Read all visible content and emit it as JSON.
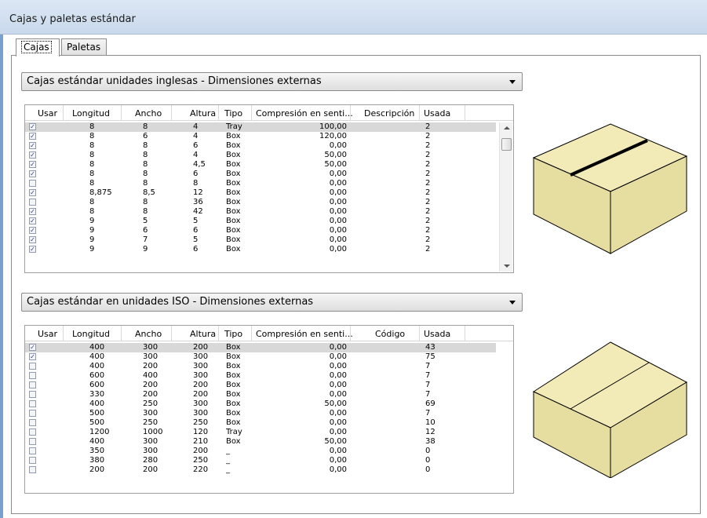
{
  "window": {
    "title": "Cajas y paletas estándar"
  },
  "tabs": [
    {
      "label": "Cajas",
      "active": true
    },
    {
      "label": "Paletas",
      "active": false
    }
  ],
  "english": {
    "dropdown": "Cajas estándar unidades inglesas - Dimensiones externas",
    "columns": [
      "Usar",
      "Longitud",
      "Ancho",
      "Altura",
      "Tipo",
      "Compresión en senti...",
      "Descripción",
      "Usada"
    ],
    "rows": [
      {
        "usar": true,
        "longitud": "8",
        "ancho": "8",
        "altura": "4",
        "tipo": "Tray",
        "compresion": "100,00",
        "descripcion": "",
        "usada": "2"
      },
      {
        "usar": true,
        "longitud": "8",
        "ancho": "6",
        "altura": "4",
        "tipo": "Box",
        "compresion": "120,00",
        "descripcion": "",
        "usada": "2"
      },
      {
        "usar": true,
        "longitud": "8",
        "ancho": "8",
        "altura": "6",
        "tipo": "Box",
        "compresion": "0,00",
        "descripcion": "",
        "usada": "2"
      },
      {
        "usar": true,
        "longitud": "8",
        "ancho": "8",
        "altura": "4",
        "tipo": "Box",
        "compresion": "50,00",
        "descripcion": "",
        "usada": "2"
      },
      {
        "usar": true,
        "longitud": "8",
        "ancho": "8",
        "altura": "4,5",
        "tipo": "Box",
        "compresion": "50,00",
        "descripcion": "",
        "usada": "2"
      },
      {
        "usar": true,
        "longitud": "8",
        "ancho": "8",
        "altura": "6",
        "tipo": "Box",
        "compresion": "0,00",
        "descripcion": "",
        "usada": "2"
      },
      {
        "usar": false,
        "longitud": "8",
        "ancho": "8",
        "altura": "8",
        "tipo": "Box",
        "compresion": "0,00",
        "descripcion": "",
        "usada": "2"
      },
      {
        "usar": true,
        "longitud": "8,875",
        "ancho": "8,5",
        "altura": "12",
        "tipo": "Box",
        "compresion": "0,00",
        "descripcion": "",
        "usada": "2"
      },
      {
        "usar": false,
        "longitud": "8",
        "ancho": "8",
        "altura": "36",
        "tipo": "Box",
        "compresion": "0,00",
        "descripcion": "",
        "usada": "2"
      },
      {
        "usar": true,
        "longitud": "8",
        "ancho": "8",
        "altura": "42",
        "tipo": "Box",
        "compresion": "0,00",
        "descripcion": "",
        "usada": "2"
      },
      {
        "usar": true,
        "longitud": "9",
        "ancho": "5",
        "altura": "5",
        "tipo": "Box",
        "compresion": "0,00",
        "descripcion": "",
        "usada": "2"
      },
      {
        "usar": true,
        "longitud": "9",
        "ancho": "6",
        "altura": "6",
        "tipo": "Box",
        "compresion": "0,00",
        "descripcion": "",
        "usada": "2"
      },
      {
        "usar": true,
        "longitud": "9",
        "ancho": "7",
        "altura": "5",
        "tipo": "Box",
        "compresion": "0,00",
        "descripcion": "",
        "usada": "2"
      },
      {
        "usar": true,
        "longitud": "9",
        "ancho": "9",
        "altura": "6",
        "tipo": "Box",
        "compresion": "0,00",
        "descripcion": "",
        "usada": "2"
      }
    ]
  },
  "iso": {
    "dropdown": "Cajas estándar en unidades ISO - Dimensiones externas",
    "columns": [
      "Usar",
      "Longitud",
      "Ancho",
      "Altura",
      "Tipo",
      "Compresión en senti...",
      "Código",
      "Usada"
    ],
    "rows": [
      {
        "usar": true,
        "longitud": "400",
        "ancho": "300",
        "altura": "200",
        "tipo": "Box",
        "compresion": "0,00",
        "codigo": "",
        "usada": "43"
      },
      {
        "usar": true,
        "longitud": "400",
        "ancho": "300",
        "altura": "300",
        "tipo": "Box",
        "compresion": "0,00",
        "codigo": "",
        "usada": "75"
      },
      {
        "usar": false,
        "longitud": "400",
        "ancho": "200",
        "altura": "300",
        "tipo": "Box",
        "compresion": "0,00",
        "codigo": "",
        "usada": "7"
      },
      {
        "usar": false,
        "longitud": "600",
        "ancho": "400",
        "altura": "300",
        "tipo": "Box",
        "compresion": "0,00",
        "codigo": "",
        "usada": "7"
      },
      {
        "usar": false,
        "longitud": "600",
        "ancho": "200",
        "altura": "200",
        "tipo": "Box",
        "compresion": "0,00",
        "codigo": "",
        "usada": "7"
      },
      {
        "usar": false,
        "longitud": "330",
        "ancho": "200",
        "altura": "200",
        "tipo": "Box",
        "compresion": "0,00",
        "codigo": "",
        "usada": "7"
      },
      {
        "usar": false,
        "longitud": "400",
        "ancho": "250",
        "altura": "300",
        "tipo": "Box",
        "compresion": "50,00",
        "codigo": "",
        "usada": "69"
      },
      {
        "usar": false,
        "longitud": "500",
        "ancho": "300",
        "altura": "300",
        "tipo": "Box",
        "compresion": "0,00",
        "codigo": "",
        "usada": "7"
      },
      {
        "usar": false,
        "longitud": "500",
        "ancho": "250",
        "altura": "250",
        "tipo": "Box",
        "compresion": "0,00",
        "codigo": "",
        "usada": "10"
      },
      {
        "usar": false,
        "longitud": "1200",
        "ancho": "1000",
        "altura": "120",
        "tipo": "Tray",
        "compresion": "0,00",
        "codigo": "",
        "usada": "12"
      },
      {
        "usar": false,
        "longitud": "400",
        "ancho": "300",
        "altura": "210",
        "tipo": "Box",
        "compresion": "50,00",
        "codigo": "",
        "usada": "38"
      },
      {
        "usar": false,
        "longitud": "350",
        "ancho": "300",
        "altura": "200",
        "tipo": "_",
        "compresion": "0,00",
        "codigo": "",
        "usada": "0"
      },
      {
        "usar": false,
        "longitud": "380",
        "ancho": "280",
        "altura": "250",
        "tipo": "_",
        "compresion": "0,00",
        "codigo": "",
        "usada": "0"
      },
      {
        "usar": false,
        "longitud": "200",
        "ancho": "200",
        "altura": "220",
        "tipo": "_",
        "compresion": "0,00",
        "codigo": "",
        "usada": "0"
      }
    ]
  },
  "colors": {
    "box_face_top": "#f2ebb8",
    "box_face_side": "#e6dda0",
    "box_outline": "#000000",
    "selected_row": "#d8d8d8"
  }
}
